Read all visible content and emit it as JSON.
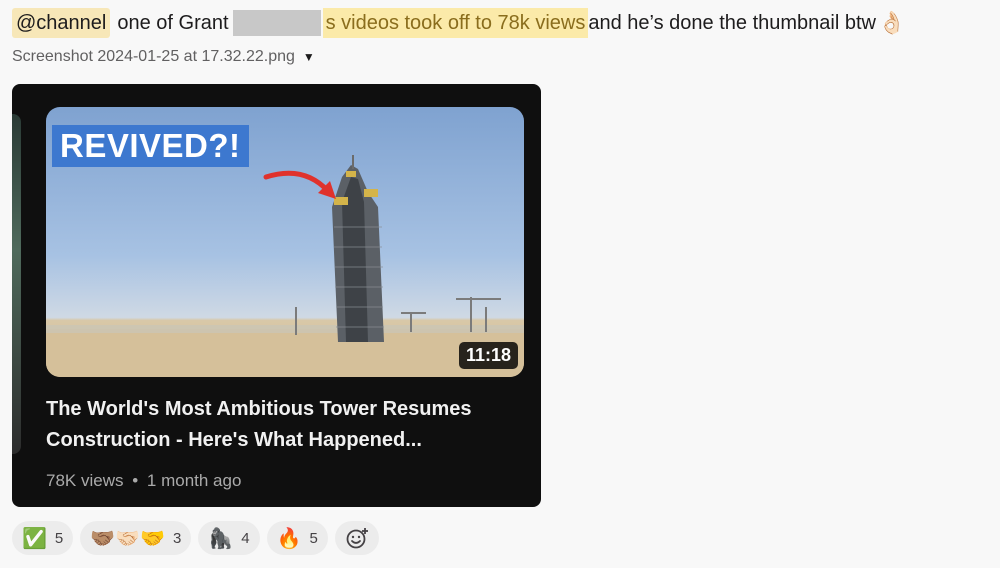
{
  "message": {
    "mention": "@channel",
    "text_before": "one of Grant",
    "redacted_end": "s",
    "highlight": "videos took off to 78k views",
    "text_after": "and he’s done the thumbnail btw",
    "emoji": "👌🏻"
  },
  "file": {
    "name": "Screenshot 2024-01-25 at 17.32.22.png",
    "caret": "▼"
  },
  "video": {
    "thumbnail_tag": "REVIVED?!",
    "duration": "11:18",
    "title": "The World's Most Ambitious Tower Resumes Construction - Here's What Happened...",
    "views": "78K views",
    "separator": "•",
    "age": "1 month ago"
  },
  "reactions": [
    {
      "emoji": "✅",
      "icon": "check-mark-icon",
      "count": "5"
    },
    {
      "emoji": "🤝🏽🤝🏻🤝",
      "icon": "handshake-icon",
      "count": "3"
    },
    {
      "emoji": "🦍",
      "icon": "gorilla-icon",
      "count": "4"
    },
    {
      "emoji": "🔥",
      "icon": "fire-icon",
      "count": "5"
    }
  ]
}
